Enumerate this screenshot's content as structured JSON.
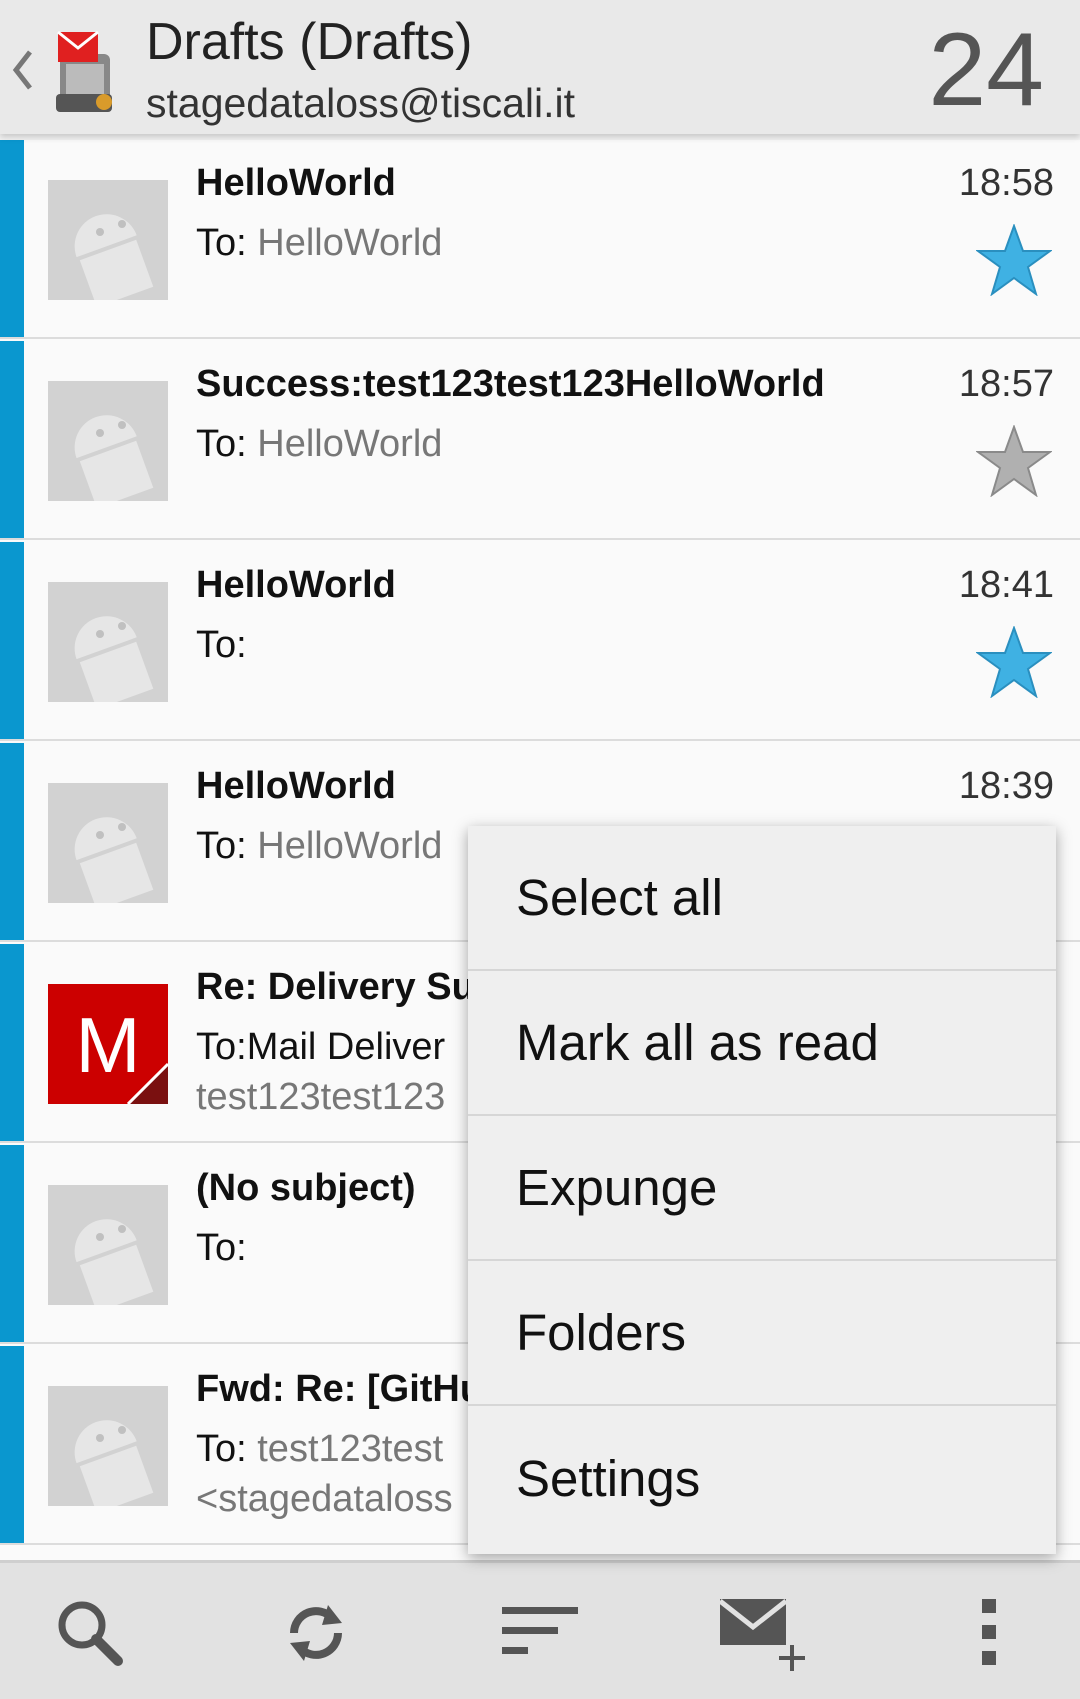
{
  "header": {
    "title": "Drafts (Drafts)",
    "account": "stagedataloss@tiscali.it",
    "count": "24"
  },
  "messages": [
    {
      "subject": "HelloWorld",
      "to_label": "To:",
      "to": "HelloWorld",
      "time": "18:58",
      "starred": true,
      "avatar": "android-avatar"
    },
    {
      "subject": "Success:test123test123HelloWorld",
      "to_label": "To:",
      "to": "HelloWorld",
      "time": "18:57",
      "starred": false,
      "avatar": "android-avatar"
    },
    {
      "subject": "HelloWorld",
      "to_label": "To:",
      "to": "",
      "time": "18:41",
      "starred": true,
      "avatar": "android-avatar"
    },
    {
      "subject": "HelloWorld",
      "to_label": "To: ",
      "to": "HelloWorld",
      "time": "18:39",
      "avatar": "android-avatar"
    },
    {
      "subject": "Re: Delivery Su",
      "to_label": "To:Mail Deliver",
      "to": "",
      "preview": "test123test123",
      "avatar_letter": "M",
      "avatar": "letter-avatar"
    },
    {
      "subject": "(No subject)",
      "to_label": "To:",
      "to": "",
      "avatar": "android-avatar"
    },
    {
      "subject": "Fwd: Re: [GitHu",
      "to_label": "To: ",
      "to": "test123test",
      "preview": "<stagedataloss",
      "avatar": "android-avatar"
    }
  ],
  "menu": {
    "items": [
      "Select all",
      "Mark all as read",
      "Expunge",
      "Folders",
      "Settings"
    ]
  },
  "bottombar": {
    "icons": [
      "search-icon",
      "refresh-icon",
      "sort-icon",
      "compose-icon",
      "overflow-menu-icon"
    ]
  },
  "colors": {
    "accent": "#0a97cf",
    "star_on": "#3fb1e3",
    "star_off": "#b0b0b0",
    "letter_avatar": "#cc0000"
  }
}
